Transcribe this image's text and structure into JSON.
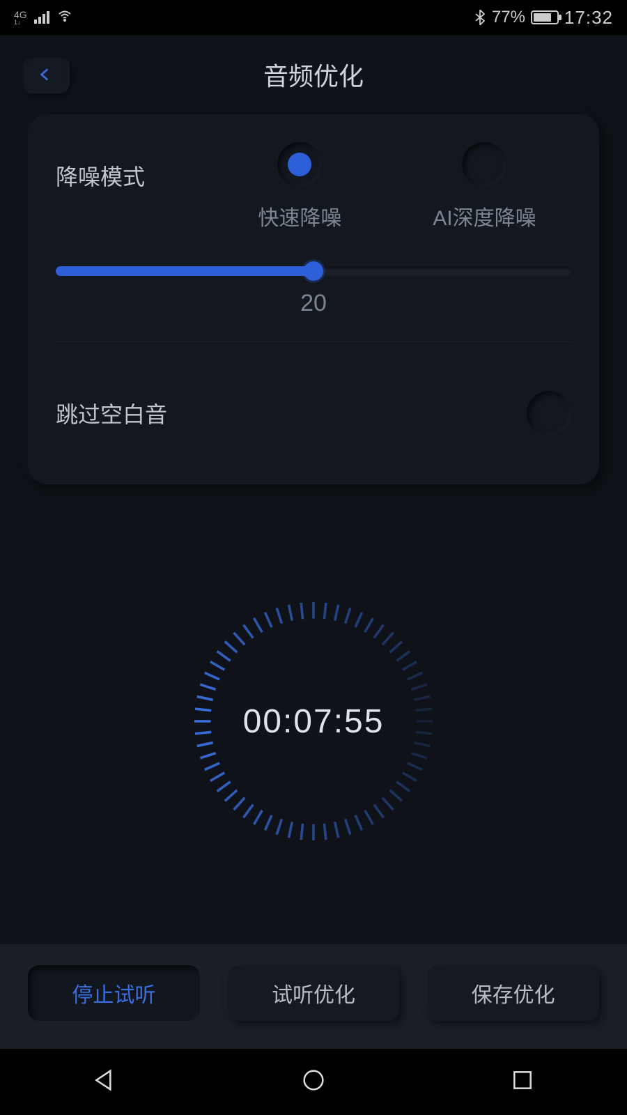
{
  "status": {
    "network": "4G",
    "battery_pct": "77%",
    "time": "17:32",
    "battery_fill_pct": 77
  },
  "header": {
    "title": "音频优化"
  },
  "noise": {
    "label": "降噪模式",
    "options": [
      {
        "label": "快速降噪",
        "selected": true
      },
      {
        "label": "AI深度降噪",
        "selected": false
      }
    ],
    "slider_value": "20",
    "slider_pct": 50
  },
  "skip": {
    "label": "跳过空白音",
    "enabled": false
  },
  "timer": {
    "display": "00:07:55"
  },
  "actions": {
    "stop": "停止试听",
    "preview": "试听优化",
    "save": "保存优化"
  }
}
